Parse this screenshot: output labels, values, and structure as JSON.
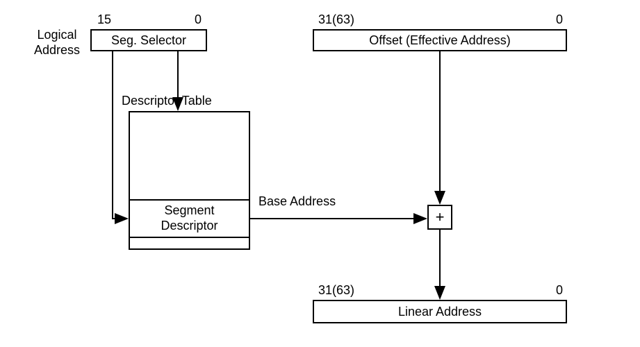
{
  "logicalAddressLabel": "Logical\nAddress",
  "segSelector": {
    "bitHigh": "15",
    "bitLow": "0",
    "label": "Seg. Selector"
  },
  "offset": {
    "bitHigh": "31(63)",
    "bitLow": "0",
    "label": "Offset (Effective Address)"
  },
  "descriptorTable": {
    "title": "Descriptor Table",
    "entryLabel": "Segment\nDescriptor"
  },
  "baseAddressLabel": "Base Address",
  "adderSymbol": "+",
  "linearAddress": {
    "bitHigh": "31(63)",
    "bitLow": "0",
    "label": "Linear Address"
  }
}
